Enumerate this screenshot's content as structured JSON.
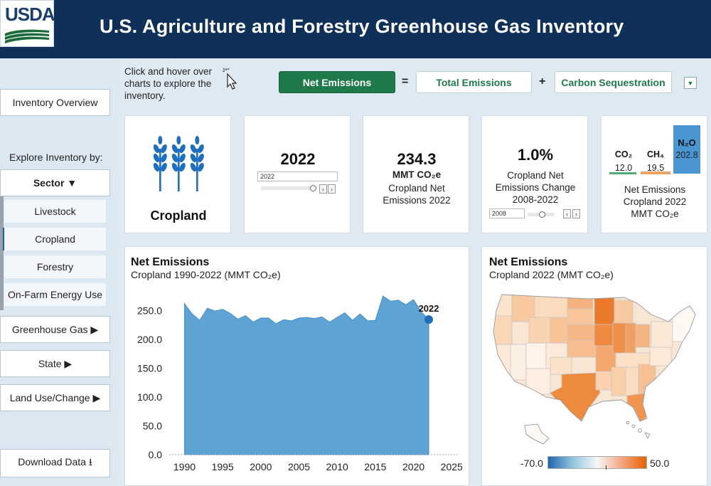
{
  "header": {
    "logo_text": "USDA",
    "title": "U.S. Agriculture and Forestry Greenhouse Gas Inventory",
    "bg": "#0f3058"
  },
  "sidebar": {
    "overview": "Inventory Overview",
    "explore_label": "Explore Inventory by:",
    "sector": "Sector ▼",
    "sectors": [
      "Livestock",
      "Cropland",
      "Forestry",
      "On-Farm Energy Use"
    ],
    "active_sector": "Cropland",
    "greenhouse_gas": "Greenhouse Gas ▶",
    "state": "State ▶",
    "land_use": "Land Use/Change ▶",
    "download": "Download Data ⭳"
  },
  "hint": "Click and hover over charts to explore the inventory.",
  "equation": {
    "net": "Net Emissions",
    "eq": "=",
    "total": "Total Emissions",
    "plus": "+",
    "sequestration": "Carbon Sequestration",
    "accent": "#1e7a4a"
  },
  "cards": {
    "sector_name": "Cropland",
    "sector_icon": "wheat-icon",
    "year": {
      "value": "2022",
      "input": "2022"
    },
    "net": {
      "value": "234.3",
      "unit": "MMT CO₂e",
      "label": "Cropland Net Emissions 2022"
    },
    "change": {
      "value": "1.0%",
      "label": "Cropland Net Emissions Change 2008-2022",
      "input": "2008"
    },
    "gases": {
      "co2_label": "CO₂",
      "co2_value": "12.0",
      "ch4_label": "CH₄",
      "ch4_value": "19.5",
      "n2o_label": "N₂O",
      "n2o_value": "202.8",
      "caption": "Net Emissions Cropland 2022 MMT CO₂e"
    }
  },
  "chart_data": [
    {
      "type": "area",
      "title": "Net Emissions",
      "subtitle": "Cropland 1990-2022 (MMT CO₂e)",
      "x": [
        1990,
        1991,
        1992,
        1993,
        1994,
        1995,
        1996,
        1997,
        1998,
        1999,
        2000,
        2001,
        2002,
        2003,
        2004,
        2005,
        2006,
        2007,
        2008,
        2009,
        2010,
        2011,
        2012,
        2013,
        2014,
        2015,
        2016,
        2017,
        2018,
        2019,
        2020,
        2021,
        2022
      ],
      "y": [
        262,
        244,
        233,
        254,
        249,
        252,
        245,
        235,
        241,
        230,
        237,
        237,
        227,
        234,
        232,
        237,
        238,
        236,
        239,
        230,
        238,
        246,
        233,
        244,
        232,
        233,
        275,
        266,
        268,
        260,
        269,
        248,
        234.3
      ],
      "xticks": [
        "1990",
        "1995",
        "2000",
        "2005",
        "2010",
        "2015",
        "2020",
        "2025"
      ],
      "yticks": [
        "0.0",
        "50.0",
        "100.0",
        "150.0",
        "200.0",
        "250.0"
      ],
      "xlim": [
        1988,
        2026
      ],
      "ylim": [
        0,
        280
      ],
      "annotation": "2022",
      "color": "#5da3d3"
    },
    {
      "type": "map",
      "title": "Net Emissions",
      "subtitle": "Cropland 2022 (MMT CO₂e)",
      "legend_min": "-70.0",
      "legend_max": "50.0",
      "color_low": "#2166ac",
      "color_high": "#e66101"
    }
  ]
}
